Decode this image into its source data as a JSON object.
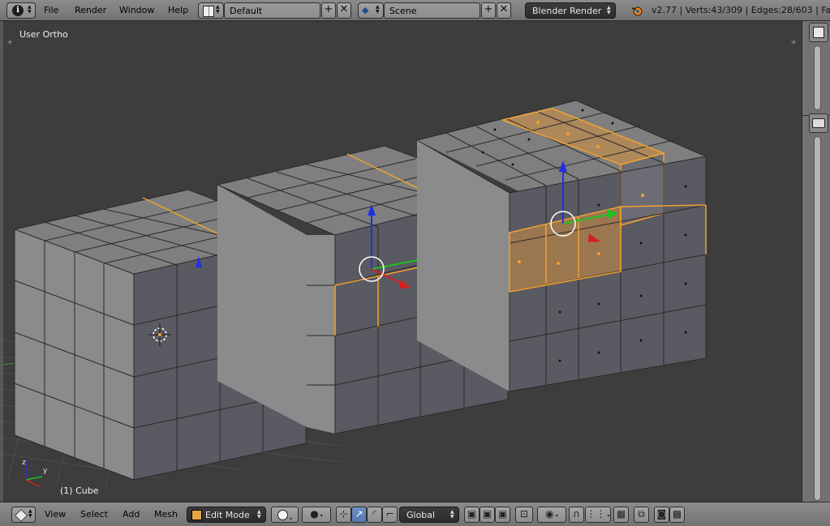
{
  "info_header": {
    "editor_icon": "info-icon",
    "menus": [
      "File",
      "Render",
      "Window",
      "Help"
    ],
    "screen_layout": "Default",
    "scene": "Scene",
    "render_engine": "Blender Render",
    "stats": "v2.77 | Verts:43/309 | Edges:28/603 | Face"
  },
  "viewport": {
    "view_name": "User Ortho",
    "object_name": "(1) Cube",
    "axis_labels": {
      "z": "z",
      "y": "y"
    }
  },
  "view3d_header": {
    "editor_icon": "view3d-icon",
    "menus": [
      "View",
      "Select",
      "Add",
      "Mesh"
    ],
    "mode": "Edit Mode",
    "orientation": "Global"
  },
  "colors": {
    "background": "#3d3d3d",
    "selection": "#f2a130",
    "x_axis": "#d42020",
    "y_axis": "#20c020",
    "z_axis": "#2030e0",
    "active_toggle": "#5f82bb"
  }
}
